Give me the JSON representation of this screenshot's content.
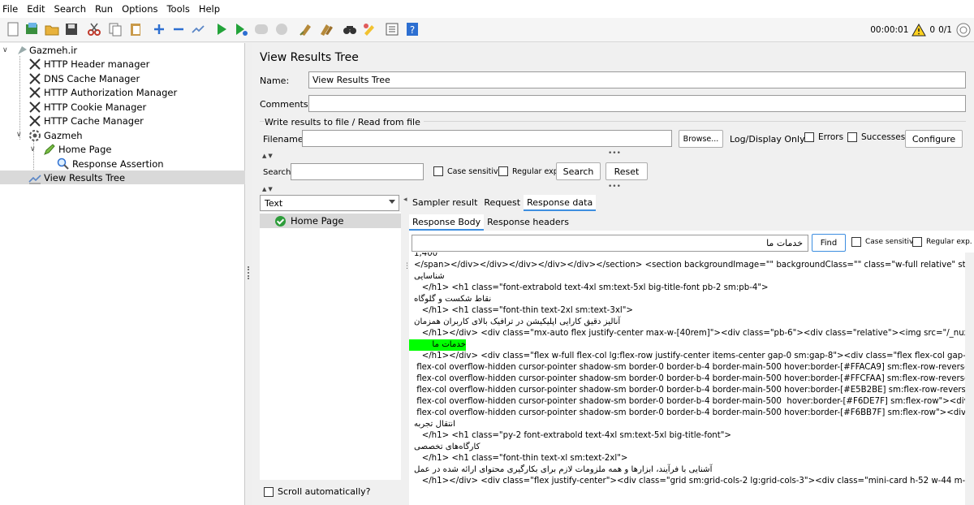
{
  "menu": [
    "File",
    "Edit",
    "Search",
    "Run",
    "Options",
    "Tools",
    "Help"
  ],
  "status": {
    "timer": "00:00:01",
    "warnings": "0",
    "threads": "0/1"
  },
  "tree": {
    "root": "Gazmeh.ir",
    "items": [
      "HTTP Header manager",
      "DNS Cache Manager",
      "HTTP Authorization Manager",
      "HTTP Cookie Manager",
      "HTTP Cache Manager",
      "Gazmeh",
      "Home Page",
      "Response Assertion",
      "View Results Tree"
    ]
  },
  "panel": {
    "title": "View Results Tree",
    "name_label": "Name:",
    "name_value": "View Results Tree",
    "comments_label": "Comments:",
    "write_group": "Write results to file / Read from file",
    "filename_label": "Filename",
    "browse": "Browse...",
    "logdisplay_label": "Log/Display Only:",
    "errors": "Errors",
    "successes": "Successes",
    "configure": "Configure",
    "search_label": "Search:",
    "case_sensitive": "Case sensitive",
    "regular_exp": "Regular exp.",
    "search_btn": "Search",
    "reset_btn": "Reset"
  },
  "results": {
    "renderer": "Text",
    "sample": "Home Page",
    "scroll_auto": "Scroll automatically?"
  },
  "tabs": [
    "Sampler result",
    "Request",
    "Response data"
  ],
  "subtabs": [
    "Response Body",
    "Response headers"
  ],
  "find": {
    "value": "خدمات ما",
    "button": "Find",
    "case_sensitive": "Case sensitive",
    "regular_exp": "Regular exp."
  },
  "body_lines": [
    "1,400",
    "</span></div></div></div></div></div></section> <section backgroundImage=\"\" backgroundClass=\"\" class=\"w-full relative\" style=\"backgrc",
    "شناسایی",
    "   </h1> <h1 class=\"font-extrabold text-4xl sm:text-5xl big-title-font pb-2 sm:pb-4\">",
    "نقاط شکست و گلوگاه",
    "   </h1> <h1 class=\"font-thin text-2xl sm:text-3xl\">",
    "آنالیز دقیق کارایی اپلیکیشن در ترافیک بالای کاربران همزمان",
    "   </h1></div> <div class=\"mx-auto flex justify-center max-w-[40rem]\"><div class=\"pb-6\"><div class=\"relative\"><img src=\"/_nuxt/img/dashl",
    "خدمات ما",
    "   </h1></div> <div class=\"flex w-full flex-col lg:flex-row justify-center items-center gap-0 sm:gap-8\"><div class=\"flex flex-col gap-6\"><a href",
    " flex-col overflow-hidden cursor-pointer shadow-sm border-0 border-b-4 border-main-500 hover:border-[#FFACA9] sm:flex-row-reverse\"><div c",
    " flex-col overflow-hidden cursor-pointer shadow-sm border-0 border-b-4 border-main-500 hover:border-[#FFCFAA] sm:flex-row-reverse\"><div c",
    " flex-col overflow-hidden cursor-pointer shadow-sm border-0 border-b-4 border-main-500 hover:border-[#E5B2BE] sm:flex-row-reverse\"><div c",
    " flex-col overflow-hidden cursor-pointer shadow-sm border-0 border-b-4 border-main-500  hover:border-[#F6DE7F] sm:flex-row\"><div class=\"w",
    " flex-col overflow-hidden cursor-pointer shadow-sm border-0 border-b-4 border-main-500 hover:border-[#F6BB7F] sm:flex-row\"><div class=\"w-",
    "انتقال تجربه",
    "   </h1> <h1 class=\"py-2 font-extrabold text-4xl sm:text-5xl big-title-font\">",
    "کارگاه‌های تخصصی",
    "   </h1> <h1 class=\"font-thin text-xl sm:text-2xl\">",
    "آشنایی با فرآیند، ابزارها و همه ملزومات لازم برای بکارگیری محتوای ارائه شده در عمل",
    "   </h1></div> <div class=\"flex justify-center\"><div class=\"grid sm:grid-cols-2 lg:grid-cols-3\"><div class=\"mini-card h-52 w-44 m-4 cursor-po"
  ],
  "colors": {
    "highlight": "#00ff00",
    "tab_underline": "#3d8ee0",
    "selection": "#d9d9d9"
  }
}
